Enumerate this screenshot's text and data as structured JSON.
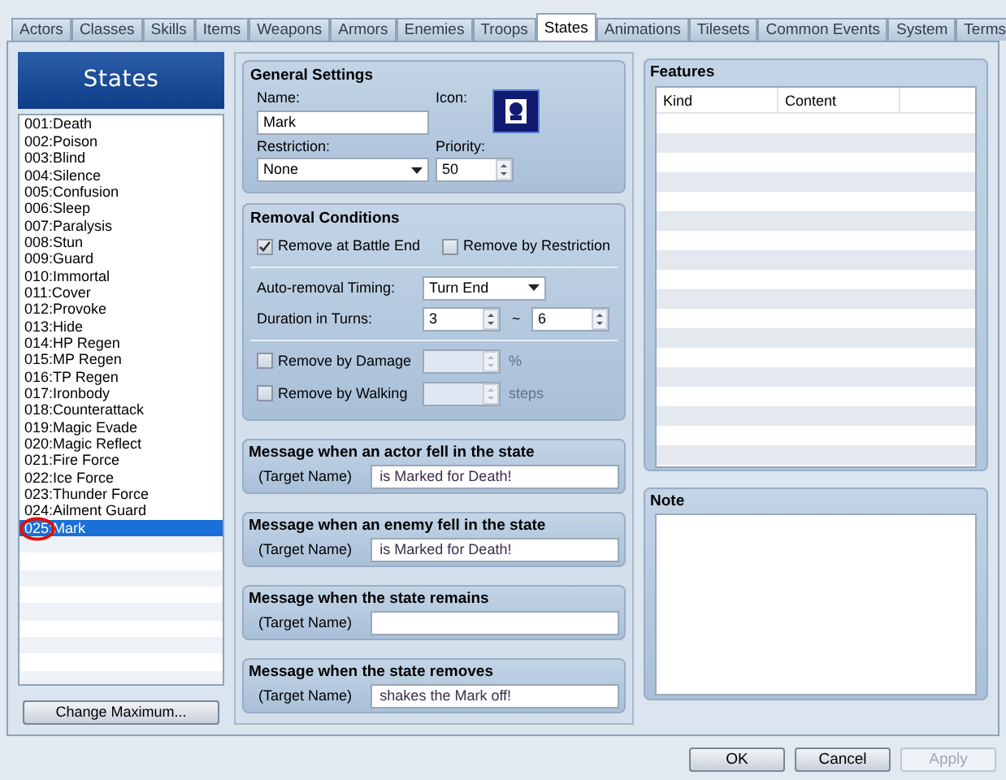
{
  "tabs": [
    {
      "label": "Actors",
      "selected": false
    },
    {
      "label": "Classes",
      "selected": false
    },
    {
      "label": "Skills",
      "selected": false
    },
    {
      "label": "Items",
      "selected": false
    },
    {
      "label": "Weapons",
      "selected": false
    },
    {
      "label": "Armors",
      "selected": false
    },
    {
      "label": "Enemies",
      "selected": false
    },
    {
      "label": "Troops",
      "selected": false
    },
    {
      "label": "States",
      "selected": true
    },
    {
      "label": "Animations",
      "selected": false
    },
    {
      "label": "Tilesets",
      "selected": false
    },
    {
      "label": "Common Events",
      "selected": false
    },
    {
      "label": "System",
      "selected": false
    },
    {
      "label": "Terms",
      "selected": false
    }
  ],
  "list": {
    "title": "States",
    "items": [
      {
        "label": "001:Death",
        "selected": false
      },
      {
        "label": "002:Poison",
        "selected": false
      },
      {
        "label": "003:Blind",
        "selected": false
      },
      {
        "label": "004:Silence",
        "selected": false
      },
      {
        "label": "005:Confusion",
        "selected": false
      },
      {
        "label": "006:Sleep",
        "selected": false
      },
      {
        "label": "007:Paralysis",
        "selected": false
      },
      {
        "label": "008:Stun",
        "selected": false
      },
      {
        "label": "009:Guard",
        "selected": false
      },
      {
        "label": "010:Immortal",
        "selected": false
      },
      {
        "label": "011:Cover",
        "selected": false
      },
      {
        "label": "012:Provoke",
        "selected": false
      },
      {
        "label": "013:Hide",
        "selected": false
      },
      {
        "label": "014:HP Regen",
        "selected": false
      },
      {
        "label": "015:MP Regen",
        "selected": false
      },
      {
        "label": "016:TP Regen",
        "selected": false
      },
      {
        "label": "017:Ironbody",
        "selected": false
      },
      {
        "label": "018:Counterattack",
        "selected": false
      },
      {
        "label": "019:Magic Evade",
        "selected": false
      },
      {
        "label": "020:Magic Reflect",
        "selected": false
      },
      {
        "label": "021:Fire Force",
        "selected": false
      },
      {
        "label": "022:Ice Force",
        "selected": false
      },
      {
        "label": "023:Thunder Force",
        "selected": false
      },
      {
        "label": "024:Ailment Guard",
        "selected": false
      },
      {
        "label": "025:Mark",
        "selected": true
      }
    ],
    "button": "Change Maximum..."
  },
  "general": {
    "title": "General Settings",
    "name_label": "Name:",
    "name": "Mark",
    "icon_label": "Icon:",
    "restriction_label": "Restriction:",
    "restriction": "None",
    "priority_label": "Priority:",
    "priority": "50"
  },
  "removal": {
    "title": "Removal Conditions",
    "checks": [
      {
        "label": "Remove at Battle End",
        "checked": true
      },
      {
        "label": "Remove by Restriction",
        "checked": false
      }
    ],
    "timing_label": "Auto-removal Timing:",
    "timing": "Turn End",
    "duration_label": "Duration in Turns:",
    "duration_min": "3",
    "tilde": "~",
    "duration_max": "6",
    "conditions": [
      {
        "label": "Remove by Damage",
        "checked": false,
        "unit": "%",
        "disabled": true
      },
      {
        "label": "Remove by Walking",
        "checked": false,
        "unit": "steps",
        "disabled": true
      }
    ]
  },
  "messages": [
    {
      "title": "Message when an actor fell in the state",
      "label": "(Target Name)",
      "value": "is Marked for Death!"
    },
    {
      "title": "Message when an enemy fell in the state",
      "label": "(Target Name)",
      "value": "is Marked for Death!"
    },
    {
      "title": "Message when the state remains",
      "label": "(Target Name)"
    },
    {
      "title": "Message when the state removes",
      "label": "(Target Name)",
      "value": "shakes the Mark off!"
    }
  ],
  "features": {
    "title": "Features",
    "columns": [
      "Kind",
      "Content"
    ]
  },
  "note": {
    "title": "Note"
  },
  "buttons": [
    {
      "label": "OK",
      "disabled": false
    },
    {
      "label": "Cancel",
      "disabled": false
    },
    {
      "label": "Apply",
      "disabled": true
    }
  ]
}
